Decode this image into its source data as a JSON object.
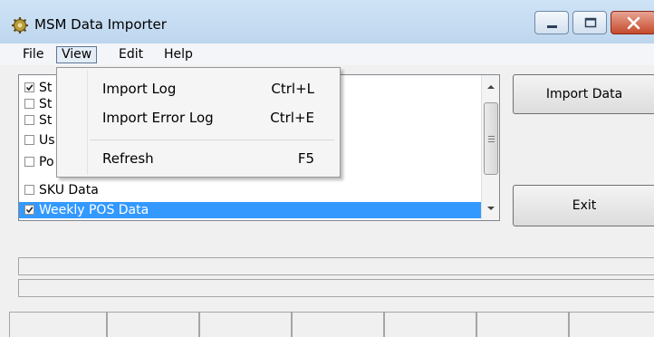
{
  "window": {
    "title": "MSM Data Importer",
    "app_icon": "gear-icon",
    "controls": [
      "minimize-icon",
      "maximize-icon",
      "close-icon"
    ]
  },
  "menubar": {
    "file": "File",
    "view": "View",
    "edit": "Edit",
    "help": "Help",
    "active": "View"
  },
  "view_menu": {
    "items": [
      {
        "label": "Import Log",
        "shortcut": "Ctrl+L"
      },
      {
        "label": "Import Error Log",
        "shortcut": "Ctrl+E"
      },
      {
        "label": "Refresh",
        "shortcut": "F5"
      }
    ]
  },
  "list": {
    "items": [
      {
        "label": "St",
        "checked": true,
        "selected": false
      },
      {
        "label": "St",
        "checked": false,
        "selected": false
      },
      {
        "label": "St",
        "checked": false,
        "selected": false
      },
      {
        "label": "Us",
        "checked": false,
        "selected": false
      },
      {
        "label": "Po",
        "checked": false,
        "selected": false
      },
      {
        "label": "SKU Data",
        "checked": false,
        "selected": false
      },
      {
        "label": "Weekly POS Data",
        "checked": true,
        "selected": true
      }
    ]
  },
  "buttons": {
    "import_label": "Import Data",
    "exit_label": "Exit"
  },
  "colors": {
    "selection": "#3399ff",
    "titlebar": "#c6dcf2",
    "close_button": "#c54a2c",
    "window_bg": "#f0f0f0"
  }
}
